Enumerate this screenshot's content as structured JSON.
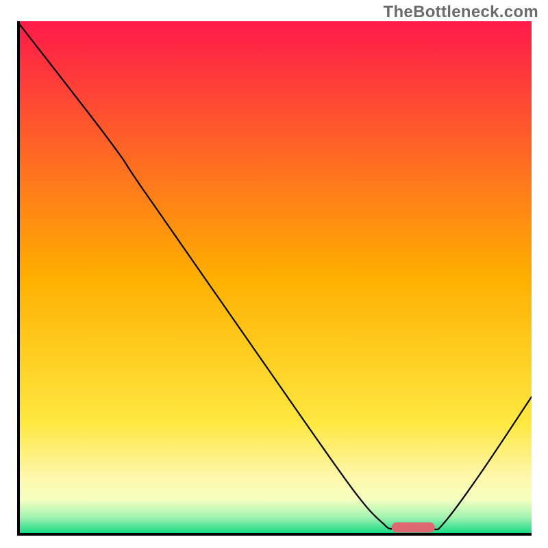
{
  "watermark": {
    "text": "TheBottleneck.com"
  },
  "chart_data": {
    "type": "line",
    "title": "",
    "xlabel": "",
    "ylabel": "",
    "xlim": [
      0,
      100
    ],
    "ylim": [
      0,
      100
    ],
    "grid": false,
    "background_gradient": {
      "orientation": "vertical",
      "stops": [
        {
          "offset": 0.0,
          "color": "#ff1a4a"
        },
        {
          "offset": 0.5,
          "color": "#ffb000"
        },
        {
          "offset": 0.78,
          "color": "#ffe840"
        },
        {
          "offset": 0.88,
          "color": "#fff6a6"
        },
        {
          "offset": 0.93,
          "color": "#f5ffc0"
        },
        {
          "offset": 0.965,
          "color": "#9ff2b0"
        },
        {
          "offset": 1.0,
          "color": "#00d87e"
        }
      ]
    },
    "series": [
      {
        "name": "bottleneck-curve",
        "color": "#000000",
        "width": 2.2,
        "points": [
          {
            "x": 0.0,
            "y": 100.0
          },
          {
            "x": 14.0,
            "y": 82.0
          },
          {
            "x": 20.0,
            "y": 74.0
          },
          {
            "x": 24.0,
            "y": 68.0
          },
          {
            "x": 40.0,
            "y": 45.0
          },
          {
            "x": 56.0,
            "y": 22.0
          },
          {
            "x": 66.0,
            "y": 8.0
          },
          {
            "x": 71.0,
            "y": 2.5
          },
          {
            "x": 73.5,
            "y": 1.2
          },
          {
            "x": 80.5,
            "y": 1.2
          },
          {
            "x": 83.0,
            "y": 2.5
          },
          {
            "x": 90.0,
            "y": 12.0
          },
          {
            "x": 100.0,
            "y": 27.0
          }
        ]
      }
    ],
    "marker": {
      "color": "#e06873",
      "shape": "rounded-rect",
      "x_center": 77.0,
      "y_center": 1.6,
      "width": 8.4,
      "height": 2.0,
      "corner_radius": 1.0
    },
    "axis_lines": {
      "color": "#000000",
      "width": 4
    }
  }
}
